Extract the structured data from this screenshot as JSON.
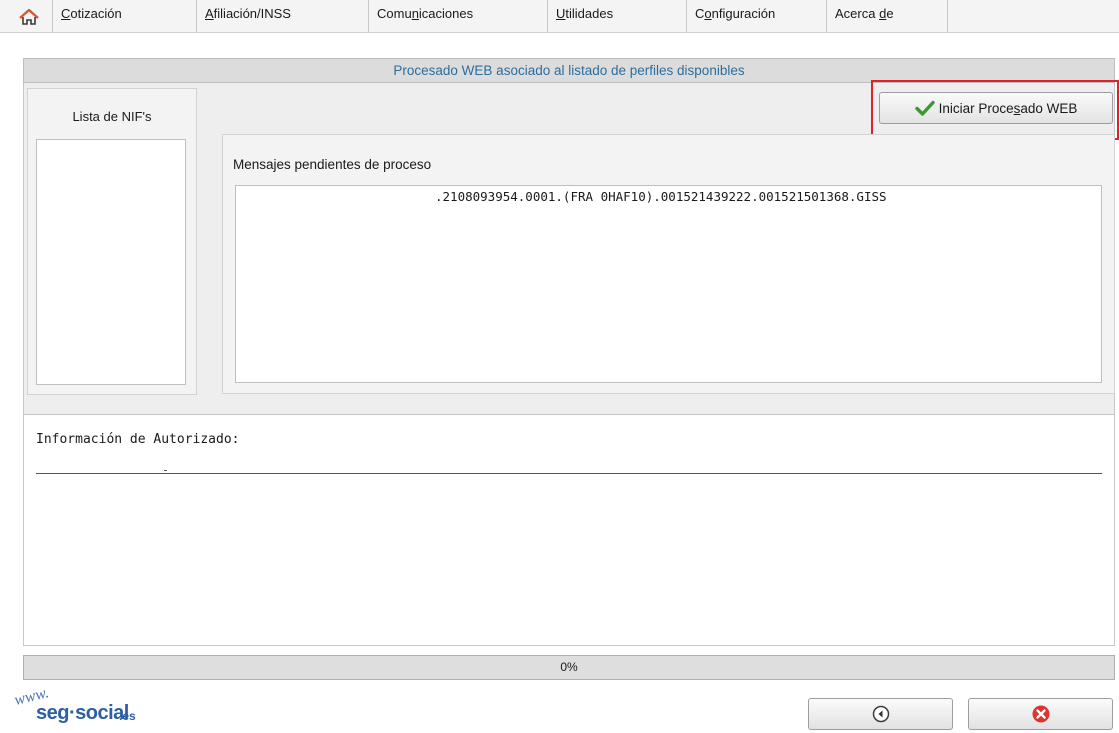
{
  "menu": {
    "home_icon": "home-icon",
    "items": [
      {
        "pre": "",
        "mn": "C",
        "post": "otización"
      },
      {
        "pre": "",
        "mn": "A",
        "post": "filiación/INSS"
      },
      {
        "pre": "Comu",
        "mn": "n",
        "post": "icaciones"
      },
      {
        "pre": "",
        "mn": "U",
        "post": "tilidades"
      },
      {
        "pre": "C",
        "mn": "o",
        "post": "nfiguración"
      },
      {
        "pre": "Acerca ",
        "mn": "d",
        "post": "e"
      }
    ]
  },
  "header": {
    "title": "Procesado WEB asociado al listado de perfiles disponibles",
    "color": "#2c6e9e"
  },
  "nif_panel": {
    "title": "Lista de NIF's",
    "items": []
  },
  "start_button": {
    "pre": "Iniciar Proce",
    "mn": "s",
    "post": "ado WEB",
    "icon": "checkmark-icon",
    "icon_color": "#3a9a2e"
  },
  "highlight_color": "#e0202a",
  "messages": {
    "title": "Mensajes pendientes de proceso",
    "lines": [
      ".2108093954.0001.(FRA 0HAF10).001521439222.001521501368.GISS"
    ]
  },
  "auth": {
    "label": "Información de Autorizado:"
  },
  "progress": {
    "value": 0,
    "text": "0%"
  },
  "logo": {
    "www": "www.",
    "seg": "seg·social",
    "es": ".es"
  },
  "footer": {
    "back_icon": "back-arrow-icon",
    "close_icon": "close-icon"
  }
}
